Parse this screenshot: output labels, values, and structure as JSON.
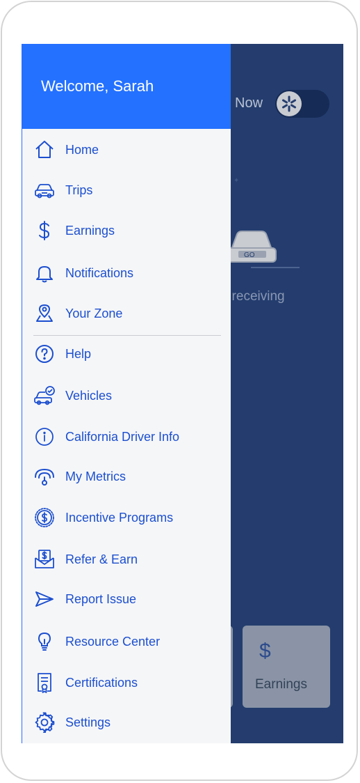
{
  "drawer": {
    "welcome": "Welcome, Sarah",
    "primary_items": [
      {
        "label": "Home",
        "icon": "home-icon"
      },
      {
        "label": "Trips",
        "icon": "car-icon"
      },
      {
        "label": "Earnings",
        "icon": "dollar-icon"
      },
      {
        "label": "Notifications",
        "icon": "bell-icon"
      },
      {
        "label": "Your Zone",
        "icon": "map-pin-icon"
      }
    ],
    "secondary_items": [
      {
        "label": "Help",
        "icon": "question-icon"
      },
      {
        "label": "Vehicles",
        "icon": "vehicle-check-icon"
      },
      {
        "label": "California Driver Info",
        "icon": "info-icon"
      },
      {
        "label": "My Metrics",
        "icon": "gauge-icon"
      },
      {
        "label": "Incentive Programs",
        "icon": "coin-icon"
      },
      {
        "label": "Refer & Earn",
        "icon": "envelope-dollar-icon"
      },
      {
        "label": "Report Issue",
        "icon": "send-icon"
      },
      {
        "label": "Resource Center",
        "icon": "lightbulb-icon"
      },
      {
        "label": "Certifications",
        "icon": "certificate-icon"
      },
      {
        "label": "Settings",
        "icon": "gear-icon"
      }
    ]
  },
  "background": {
    "now_label": "Now",
    "status_text": "t receiving",
    "earnings_card_label": "Earnings",
    "earnings_card_icon": "$"
  },
  "colors": {
    "accent": "#2471ff",
    "menu_text": "#1c4fcf",
    "overlay_bg": "#243d6e",
    "drawer_bg": "#f5f6f8"
  }
}
